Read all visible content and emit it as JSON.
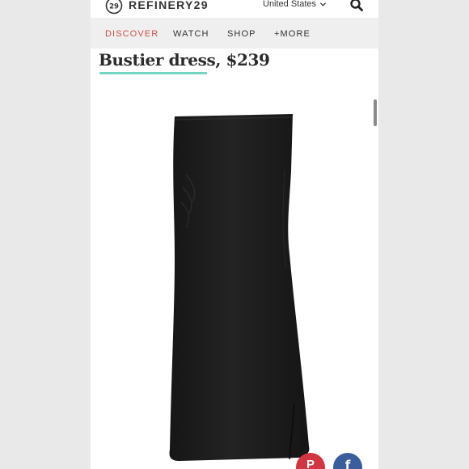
{
  "header": {
    "logo_number": "29",
    "logo_text": "REFINERY29",
    "region": "United States"
  },
  "nav": {
    "items": [
      {
        "label": "DISCOVER",
        "active": true
      },
      {
        "label": "WATCH",
        "active": false
      },
      {
        "label": "SHOP",
        "active": false
      },
      {
        "label": "+MORE",
        "active": false
      }
    ]
  },
  "article": {
    "title": "Bustier dress, $239"
  },
  "share": {
    "pinterest_glyph": "P",
    "facebook_glyph": "f"
  },
  "colors": {
    "accent_nav": "#c9524b",
    "underline": "#72d6c0",
    "pinterest": "#d23640",
    "facebook": "#3a5d9c"
  },
  "icons": [
    "logo-29-icon",
    "chevron-down-icon",
    "search-icon",
    "pinterest-icon",
    "facebook-icon"
  ]
}
